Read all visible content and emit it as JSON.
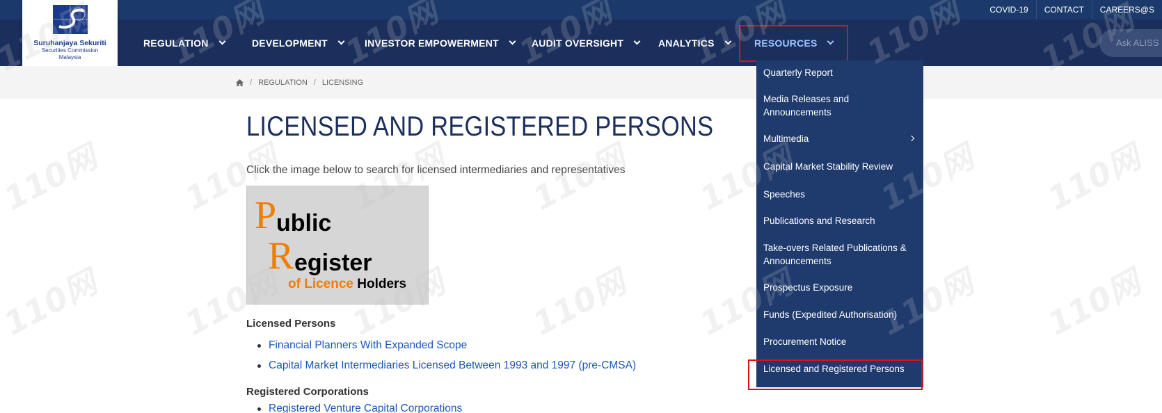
{
  "top_links": [
    "COVID-19",
    "CONTACT",
    "CAREERS@S"
  ],
  "logo": {
    "line1": "Suruhanjaya Sekuriti",
    "line2": "Securities Commission",
    "line3": "Malaysia"
  },
  "nav": {
    "items": [
      {
        "label": "REGULATION"
      },
      {
        "label": "DEVELOPMENT"
      },
      {
        "label": "INVESTOR EMPOWERMENT"
      },
      {
        "label": "AUDIT OVERSIGHT"
      },
      {
        "label": "ANALYTICS"
      },
      {
        "label": "RESOURCES",
        "active": true
      }
    ],
    "ask_placeholder": "Ask ALISS"
  },
  "breadcrumb": [
    "REGULATION",
    "LICENSING"
  ],
  "page": {
    "title": "LICENSED AND REGISTERED PERSONS",
    "intro": "Click the image below to search for licensed intermediaries and representatives",
    "register_image": {
      "p_letter": "P",
      "p_rest": "ublic",
      "r_letter": "R",
      "r_rest": "egister",
      "of_licence": "of Licence",
      "holders": "Holders"
    },
    "sections": [
      {
        "heading": "Licensed Persons",
        "links": [
          "Financial Planners With Expanded Scope",
          "Capital Market Intermediaries Licensed Between 1993 and 1997 (pre-CMSA)"
        ]
      },
      {
        "heading": "Registered Corporations",
        "links": [
          "Registered Venture Capital Corporations"
        ]
      }
    ]
  },
  "dropdown": {
    "items": [
      {
        "label": "Quarterly Report"
      },
      {
        "label": "Media Releases and Announcements"
      },
      {
        "label": "Multimedia",
        "has_submenu": true
      },
      {
        "label": "Capital Market Stability Review"
      },
      {
        "label": "Speeches"
      },
      {
        "label": "Publications and Research"
      },
      {
        "label": "Take-overs Related Publications & Announcements"
      },
      {
        "label": "Prospectus Exposure"
      },
      {
        "label": "Funds (Expedited Authorisation)"
      },
      {
        "label": "Procurement Notice"
      },
      {
        "label": "Licensed and Registered Persons",
        "highlighted": true
      }
    ]
  },
  "watermark": "110网",
  "colors": {
    "nav_bg": "#1b2f5d",
    "topbar_bg": "#1b3a6b",
    "dropdown_bg": "#1f3a6d",
    "link": "#1a56b8",
    "highlight": "#e0101a",
    "accent_orange": "#f07c00"
  }
}
